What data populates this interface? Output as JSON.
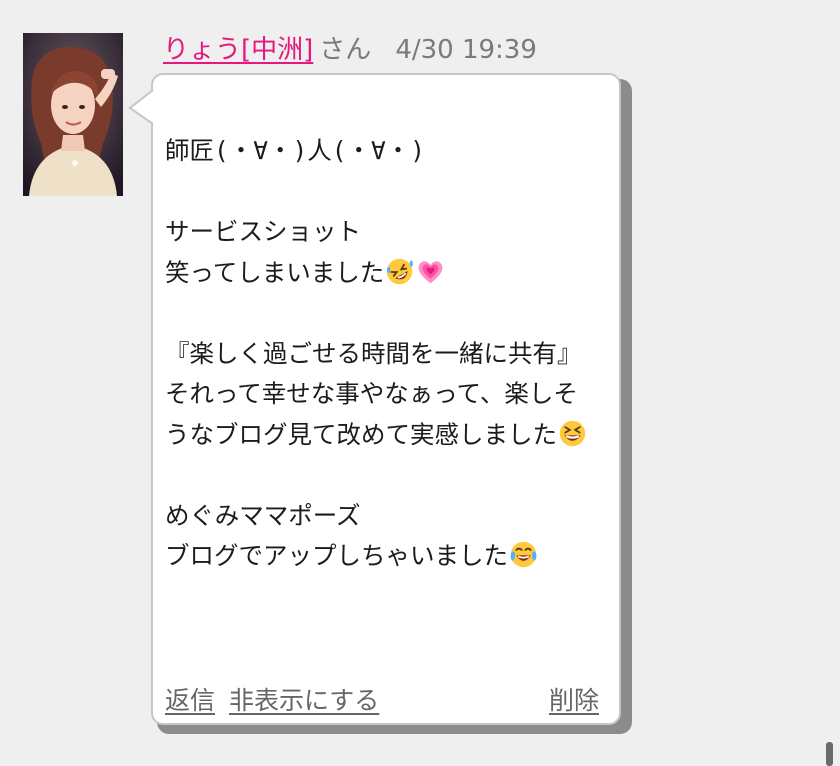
{
  "post": {
    "author": "りょう[中洲]",
    "honorific": "さん",
    "timestamp": "4/30 19:39",
    "message": {
      "p1": "師匠(・∀・)人(・∀・)",
      "p2": "サービスショット",
      "p3": "笑ってしまいました",
      "p4": "『楽しく過ごせる時間を一緒に共有』",
      "p5": "それって幸せな事やなぁって、楽しそうなブログ見て改めて実感しました",
      "p6": "めぐみママポーズ",
      "p7": "ブログでアップしちゃいました"
    },
    "actions": {
      "reply": "返信",
      "hide": "非表示にする",
      "delete": "削除"
    }
  },
  "icons": [
    "rolling-on-floor-laughing-emoji",
    "growing-heart-emoji",
    "grinning-squinting-emoji",
    "tears-of-joy-emoji"
  ],
  "colors": {
    "author_link": "#e4197d",
    "background": "#efefef",
    "bubble": "#ffffff",
    "muted_text": "#7a7a7a"
  }
}
